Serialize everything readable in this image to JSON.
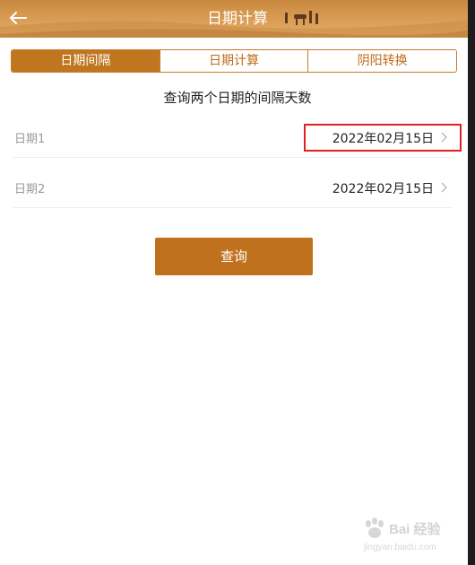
{
  "header": {
    "title": "日期计算",
    "back_icon": "arrow-left-icon"
  },
  "tabs": [
    {
      "label": "日期间隔",
      "active": true
    },
    {
      "label": "日期计算",
      "active": false
    },
    {
      "label": "阴阳转换",
      "active": false
    }
  ],
  "subtitle": "查询两个日期的间隔天数",
  "rows": [
    {
      "label": "日期1",
      "value": "2022年02月15日"
    },
    {
      "label": "日期2",
      "value": "2022年02月15日"
    }
  ],
  "query_button": "查询",
  "watermark": {
    "main": "Bai 经验",
    "sub": "jingyan.baidu.com"
  },
  "colors": {
    "accent": "#c0711d",
    "highlight": "#e02020"
  }
}
